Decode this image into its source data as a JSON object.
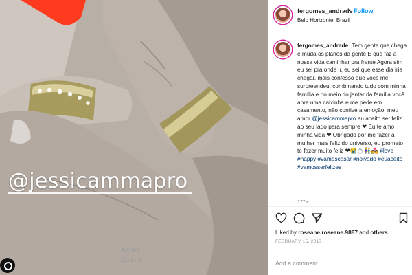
{
  "post": {
    "photo_overlay_text": "@jessicammapro"
  },
  "header": {
    "username": "fergomes_andrade",
    "separator": "•",
    "follow_label": "Follow",
    "location": "Belo Horizonte, Brazil"
  },
  "caption": {
    "username": "fergomes_andrade",
    "text_part1": "Tem gente que chega e muda os planos da gente E que faz a nossa vida caminhar pra frente Agora sim eu sei pra onde ir, eu sei que esse dia iria chegar, mais confesso que você me surpreendeu, combinando tudo com minha família e no meio do jantar da família você abre uma caixinha e me pede em casamento, não contive a emoção, meu amor",
    "mention": "@jessicammapro",
    "text_part2": "eu aceito ser feliz ao seu lado para sempre ❤ Eu te amo minha vida ❤ Obrigado por me fazer a mulher mais feliz do universo, eu prometo te fazer muito feliz ❤😭💍👫💑",
    "hashtags": [
      "#love",
      "#happy",
      "#vamoscasar",
      "#noivado",
      "#euaceito",
      "#vamosserfelizes"
    ],
    "age": "177w"
  },
  "actions": {
    "icons": [
      "heart-icon",
      "comment-icon",
      "share-icon",
      "bookmark-icon"
    ],
    "liked_by_prefix": "Liked by",
    "liked_by_user": "roseane.roseane.9887",
    "liked_by_suffix": "and",
    "liked_by_others": "others",
    "date": "FEBRUARY 15, 2017"
  },
  "comment": {
    "placeholder": "Add a comment…"
  },
  "watermark": {
    "line1": "Activa",
    "line2": "Go to S"
  },
  "colors": {
    "accent": "#0095f6",
    "link": "#003569",
    "muted": "#8e8e8e",
    "divider": "#efefef"
  }
}
